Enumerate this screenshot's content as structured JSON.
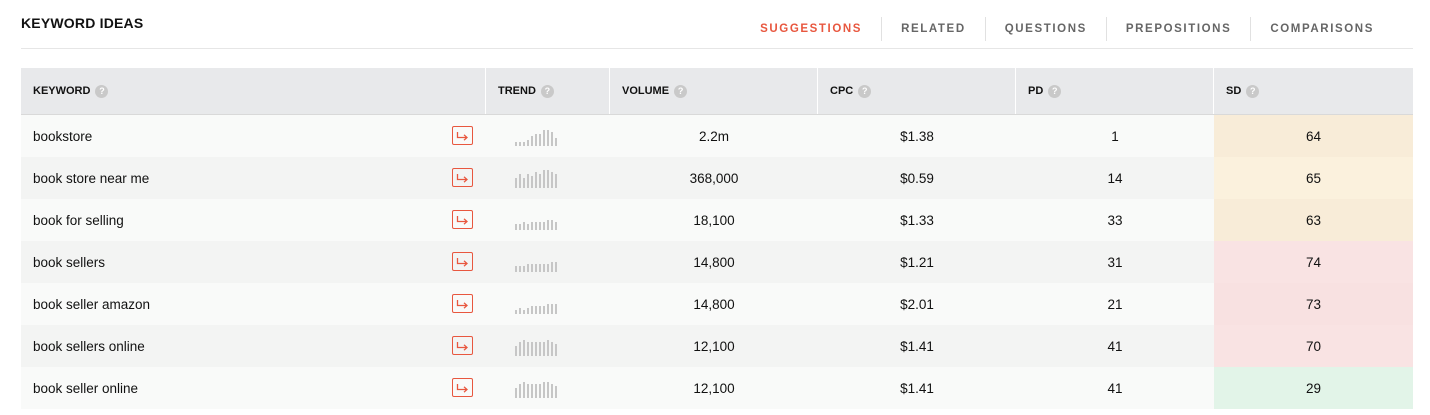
{
  "header": {
    "title": "KEYWORD IDEAS",
    "tabs": [
      {
        "label": "SUGGESTIONS",
        "active": true
      },
      {
        "label": "RELATED",
        "active": false
      },
      {
        "label": "QUESTIONS",
        "active": false
      },
      {
        "label": "PREPOSITIONS",
        "active": false
      },
      {
        "label": "COMPARISONS",
        "active": false
      }
    ],
    "accent_color": "#e8573f"
  },
  "table": {
    "columns": [
      "KEYWORD",
      "TREND",
      "VOLUME",
      "CPC",
      "PD",
      "SD"
    ],
    "help_glyph": "?",
    "rows": [
      {
        "keyword": "bookstore",
        "trend": [
          2,
          2,
          2,
          3,
          5,
          6,
          6,
          8,
          8,
          7,
          4
        ],
        "volume": "2.2m",
        "cpc": "$1.38",
        "pd": "1",
        "sd": "64",
        "sd_color": "#f8ecd8"
      },
      {
        "keyword": "book store near me",
        "trend": [
          5,
          7,
          5,
          7,
          6,
          8,
          7,
          9,
          9,
          8,
          7
        ],
        "volume": "368,000",
        "cpc": "$0.59",
        "pd": "14",
        "sd": "65",
        "sd_color": "#fbf1dd"
      },
      {
        "keyword": "book for selling",
        "trend": [
          3,
          3,
          4,
          3,
          4,
          4,
          4,
          4,
          5,
          5,
          4
        ],
        "volume": "18,100",
        "cpc": "$1.33",
        "pd": "33",
        "sd": "63",
        "sd_color": "#f8ecd8"
      },
      {
        "keyword": "book sellers",
        "trend": [
          3,
          3,
          3,
          4,
          4,
          4,
          4,
          4,
          4,
          5,
          5
        ],
        "volume": "14,800",
        "cpc": "$1.21",
        "pd": "31",
        "sd": "74",
        "sd_color": "#f9e3e3"
      },
      {
        "keyword": "book seller amazon",
        "trend": [
          2,
          3,
          2,
          3,
          4,
          4,
          4,
          4,
          5,
          5,
          5
        ],
        "volume": "14,800",
        "cpc": "$2.01",
        "pd": "21",
        "sd": "73",
        "sd_color": "#f8e1e1"
      },
      {
        "keyword": "book sellers online",
        "trend": [
          5,
          7,
          8,
          7,
          7,
          7,
          7,
          7,
          8,
          7,
          6
        ],
        "volume": "12,100",
        "cpc": "$1.41",
        "pd": "41",
        "sd": "70",
        "sd_color": "#f9e3e3"
      },
      {
        "keyword": "book seller online",
        "trend": [
          5,
          7,
          8,
          7,
          7,
          7,
          7,
          8,
          8,
          7,
          6
        ],
        "volume": "12,100",
        "cpc": "$1.41",
        "pd": "41",
        "sd": "29",
        "sd_color": "#e2f4e8"
      }
    ]
  }
}
